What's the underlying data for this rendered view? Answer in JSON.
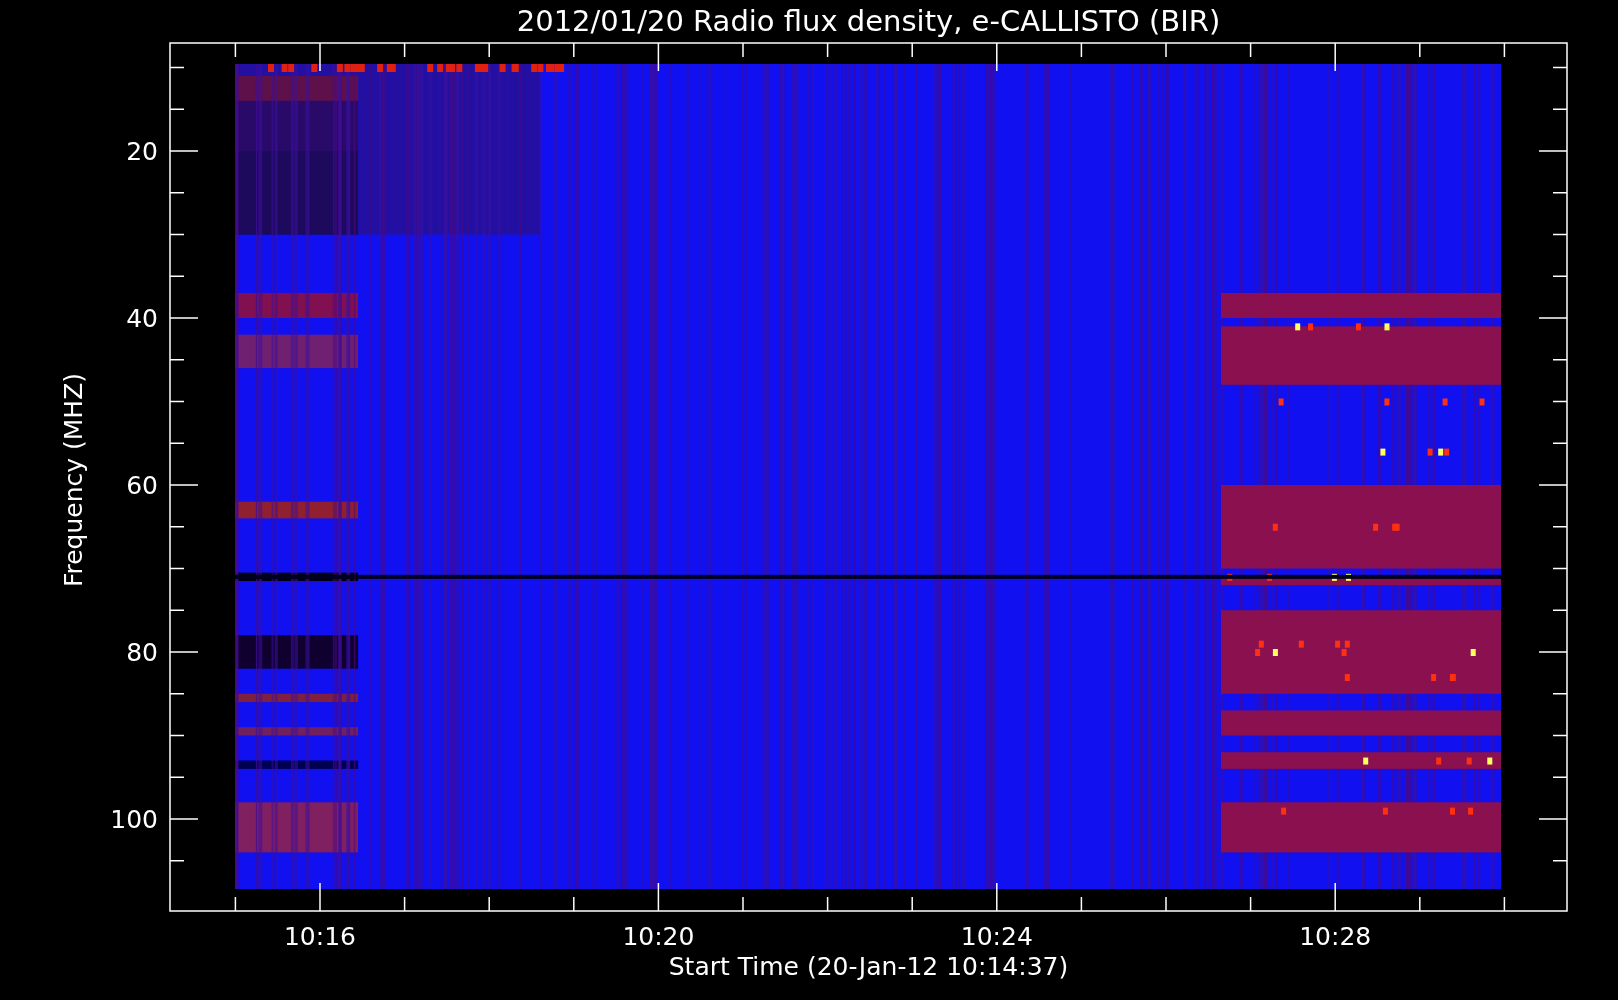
{
  "plot": {
    "title": "2012/01/20  Radio flux density, e-CALLISTO (BIR)",
    "ylabel": "Frequency (MHZ)",
    "xlabel": "Start Time (20-Jan-12 10:14:37)",
    "yticks": [
      "20",
      "40",
      "60",
      "80",
      "100"
    ],
    "xticks": [
      "10:16",
      "10:20",
      "10:24",
      "10:28"
    ]
  }
}
